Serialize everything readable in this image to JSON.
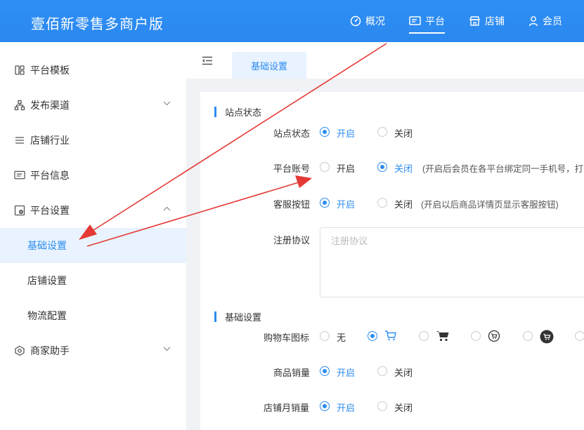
{
  "app": {
    "title": "壹佰新零售多商户版"
  },
  "topnav": [
    {
      "label": "概况",
      "icon": "dashboard-icon",
      "active": false
    },
    {
      "label": "平台",
      "icon": "monitor-icon",
      "active": true
    },
    {
      "label": "店铺",
      "icon": "store-icon",
      "active": false
    },
    {
      "label": "会员",
      "icon": "user-icon",
      "active": false
    }
  ],
  "sidebar": {
    "items": [
      {
        "label": "平台模板",
        "icon": "template-icon"
      },
      {
        "label": "发布渠道",
        "icon": "channel-icon",
        "chevron": "down"
      },
      {
        "label": "店铺行业",
        "icon": "list-icon"
      },
      {
        "label": "平台信息",
        "icon": "info-panel-icon"
      },
      {
        "label": "平台设置",
        "icon": "settings-icon",
        "chevron": "up"
      }
    ],
    "subitems": [
      {
        "label": "基础设置",
        "active": true
      },
      {
        "label": "店铺设置",
        "active": false
      },
      {
        "label": "物流配置",
        "active": false
      }
    ],
    "last_item": {
      "label": "商家助手",
      "icon": "assistant-icon",
      "chevron": "down"
    }
  },
  "tabs": {
    "active_label": "基础设置"
  },
  "sections": {
    "site_status_title": "站点状态",
    "basic_title": "基础设置"
  },
  "form": {
    "site_status": {
      "label": "站点状态",
      "on": "开启",
      "off": "关闭",
      "selected": "on"
    },
    "platform_account": {
      "label": "平台账号",
      "on": "开启",
      "off": "关闭",
      "selected": "off",
      "note": "(开启后会员在各平台绑定同一手机号，打"
    },
    "service_button": {
      "label": "客服按钮",
      "on": "开启",
      "off": "关闭",
      "selected": "on",
      "note": "(开启以后商品详情页显示客服按钮)"
    },
    "agreement": {
      "label": "注册协议",
      "placeholder": "注册协议"
    },
    "cart_icon": {
      "label": "购物车图标",
      "none": "无",
      "selected_index": 1
    },
    "product_sales": {
      "label": "商品销量",
      "on": "开启",
      "off": "关闭",
      "selected": "on"
    },
    "shop_monthly_sales": {
      "label": "店铺月销量",
      "on": "开启",
      "off": "关闭",
      "selected": "on"
    }
  },
  "colors": {
    "primary": "#2d8cf0",
    "arrow": "#e53935",
    "header": "#2d8cf0"
  }
}
